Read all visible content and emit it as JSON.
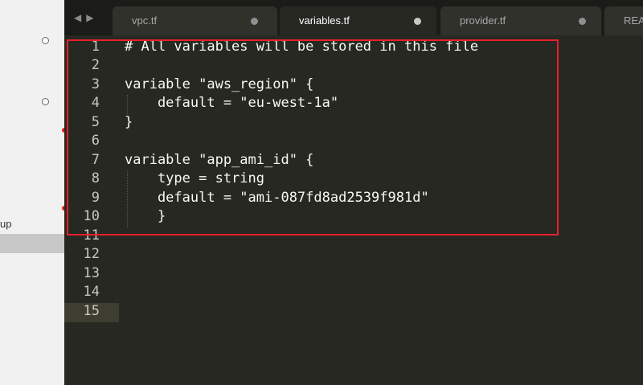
{
  "sidebar": {
    "item_label": "up"
  },
  "tabs": [
    {
      "label": "vpc.tf",
      "active": false
    },
    {
      "label": "variables.tf",
      "active": true
    },
    {
      "label": "provider.tf",
      "active": false
    },
    {
      "label": "REA",
      "active": false
    }
  ],
  "nav": {
    "back": "◀",
    "forward": "▶"
  },
  "editor": {
    "line_numbers": [
      "1",
      "2",
      "3",
      "4",
      "5",
      "6",
      "7",
      "8",
      "9",
      "10",
      "11",
      "12",
      "13",
      "14",
      "15"
    ],
    "lines": [
      "# All variables will be stored in this file",
      "",
      "variable \"aws_region\" {",
      "    default = \"eu-west-1a\"",
      "}",
      "",
      "variable \"app_ami_id\" {",
      "    type = string",
      "    default = \"ami-087fd8ad2539f981d\"",
      "    }",
      "",
      "",
      "",
      "",
      ""
    ],
    "current_line": "15"
  },
  "colors": {
    "editor_bg": "#272822",
    "text": "#f8f8f2",
    "annotation_box": "#e8202a"
  }
}
